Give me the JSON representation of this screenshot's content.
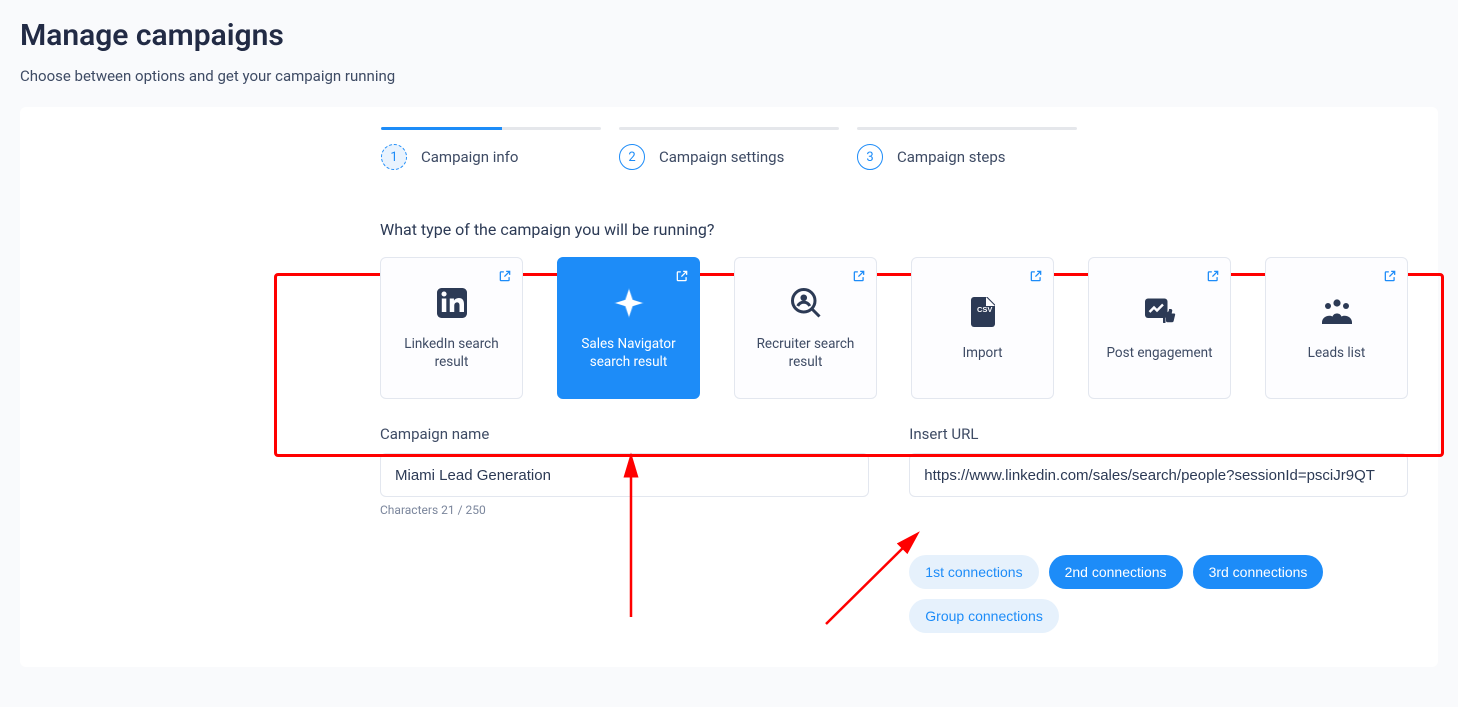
{
  "header": {
    "title": "Manage campaigns",
    "subtitle": "Choose between options and get your campaign running"
  },
  "stepper": [
    {
      "num": "1",
      "label": "Campaign info"
    },
    {
      "num": "2",
      "label": "Campaign settings"
    },
    {
      "num": "3",
      "label": "Campaign steps"
    }
  ],
  "question": "What type of the campaign you will be running?",
  "types": [
    {
      "key": "linkedin-search",
      "label": "LinkedIn search result",
      "icon": "linkedin-icon"
    },
    {
      "key": "sales-navigator",
      "label": "Sales Navigator search result",
      "icon": "compass-icon"
    },
    {
      "key": "recruiter-search",
      "label": "Recruiter search result",
      "icon": "person-search-icon"
    },
    {
      "key": "import",
      "label": "Import",
      "icon": "csv-file-icon"
    },
    {
      "key": "post-engagement",
      "label": "Post engagement",
      "icon": "chart-thumb-icon"
    },
    {
      "key": "leads-list",
      "label": "Leads list",
      "icon": "people-group-icon"
    }
  ],
  "selected_type_key": "sales-navigator",
  "form": {
    "campaign_name_label": "Campaign name",
    "campaign_name_value": "Miami Lead Generation",
    "char_counter": "Characters 21 / 250",
    "url_label": "Insert URL",
    "url_value": "https://www.linkedin.com/sales/search/people?sessionId=psciJr9QT"
  },
  "chips": [
    {
      "label": "1st connections",
      "style": "light"
    },
    {
      "label": "2nd connections",
      "style": "solid"
    },
    {
      "label": "3rd connections",
      "style": "solid"
    },
    {
      "label": "Group connections",
      "style": "light"
    }
  ]
}
